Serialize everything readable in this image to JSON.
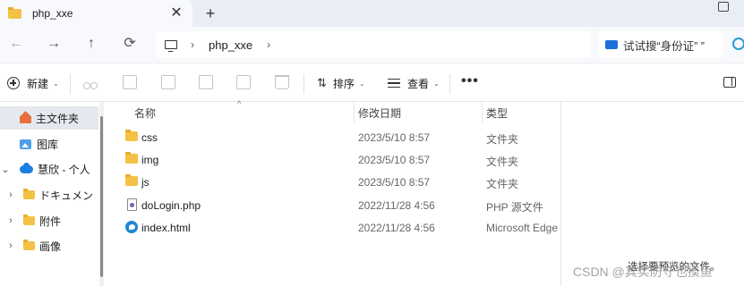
{
  "tab": {
    "title": "php_xxe",
    "close": "✕",
    "new_tab": "+"
  },
  "nav": {
    "back": "←",
    "forward": "→",
    "up": "↑",
    "refresh": "⟳"
  },
  "address": {
    "chevron": "›",
    "crumb": "php_xxe",
    "end_chevron": "›"
  },
  "search": {
    "text": "试试搜“身份证”   ”"
  },
  "toolbar": {
    "new_label": "新建",
    "sort_label": "排序",
    "view_label": "查看",
    "more": "•••",
    "caret": "⌄",
    "icons": [
      "cut-icon",
      "copy-icon",
      "paste-icon",
      "rename-icon",
      "share-icon",
      "delete-icon"
    ]
  },
  "sidebar": {
    "items": [
      {
        "label": "主文件夹",
        "icon": "home-icon"
      },
      {
        "label": "图库",
        "icon": "gallery-icon"
      },
      {
        "label": "慧欣 - 个人",
        "icon": "onedrive-icon",
        "expander": "⌄"
      },
      {
        "label": "ドキュメン",
        "icon": "folder-icon",
        "expander": "›"
      },
      {
        "label": "附件",
        "icon": "folder-icon",
        "expander": "›"
      },
      {
        "label": "画像",
        "icon": "folder-icon",
        "expander": "›"
      }
    ]
  },
  "filelist": {
    "columns": {
      "name": "名称",
      "date": "修改日期",
      "type": "类型"
    },
    "sort_arrow": "^",
    "rows": [
      {
        "name": "css",
        "date": "2023/5/10 8:57",
        "type": "文件夹",
        "icon": "folder-icon"
      },
      {
        "name": "img",
        "date": "2023/5/10 8:57",
        "type": "文件夹",
        "icon": "folder-icon"
      },
      {
        "name": "js",
        "date": "2023/5/10 8:57",
        "type": "文件夹",
        "icon": "folder-icon"
      },
      {
        "name": "doLogin.php",
        "date": "2022/11/28 4:56",
        "type": "PHP 源文件",
        "icon": "php-file-icon"
      },
      {
        "name": "index.html",
        "date": "2022/11/28 4:56",
        "type": "Microsoft Edge",
        "icon": "edge-icon"
      }
    ]
  },
  "preview": {
    "hint": "选择要预览的文件。"
  },
  "watermark": "CSDN @其实防守也摸鱼",
  "colors": {
    "accent": "#1e6fd9",
    "folder": "#f3c244",
    "selected": "#e5e9ef",
    "chrome": "#e9eef6"
  }
}
